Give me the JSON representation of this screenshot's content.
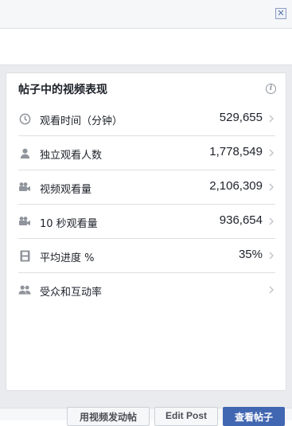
{
  "window": {
    "close_glyph": "✕"
  },
  "card": {
    "title": "帖子中的视频表现",
    "info_glyph": "i",
    "metrics": [
      {
        "icon": "clock-icon",
        "label": "观看时间（分钟）",
        "value": "529,655"
      },
      {
        "icon": "person-icon",
        "label": "独立观看人数",
        "value": "1,778,549"
      },
      {
        "icon": "video-camera-icon",
        "label": "视频观看量",
        "value": "2,106,309"
      },
      {
        "icon": "video-camera-icon",
        "label": "10 秒观看量",
        "value": "936,654"
      },
      {
        "icon": "film-icon",
        "label": "平均进度 %",
        "value": "35%"
      },
      {
        "icon": "people-icon",
        "label": "受众和互动率",
        "value": ""
      }
    ]
  },
  "footer": {
    "buttons": [
      {
        "label": "用视频发动帖"
      },
      {
        "label": "Edit Post"
      },
      {
        "label": "查看帖子"
      }
    ]
  }
}
